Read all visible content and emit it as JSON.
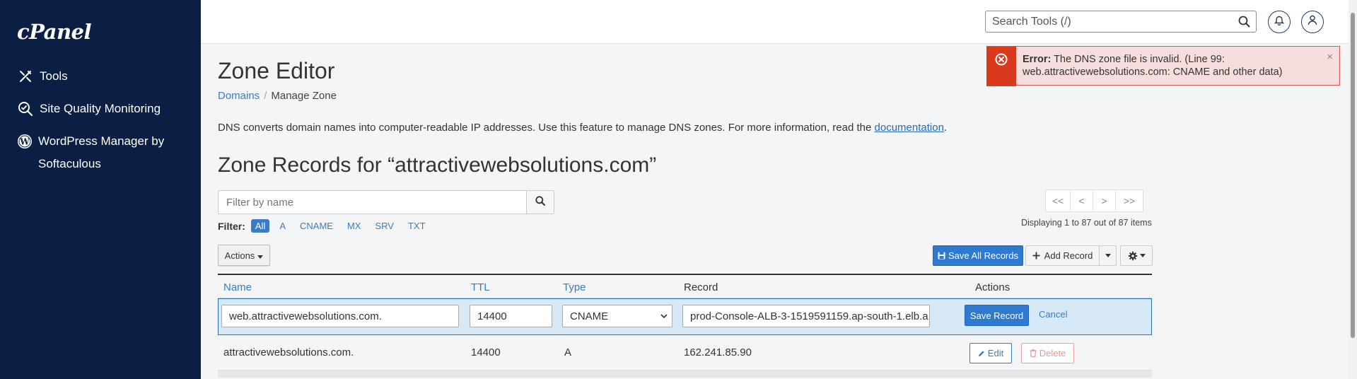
{
  "sidebar": {
    "logo": "cPanel",
    "items": [
      {
        "label": "Tools"
      },
      {
        "label": "Site Quality Monitoring"
      },
      {
        "label": "WordPress Manager by Softaculous"
      }
    ]
  },
  "header": {
    "search_placeholder": "Search Tools (/)"
  },
  "alert": {
    "prefix": "Error:",
    "message": "The DNS zone file is invalid. (Line 99: web.attractivewebsolutions.com: CNAME and other data)",
    "close": "×"
  },
  "page": {
    "title": "Zone Editor",
    "breadcrumb": {
      "parent": "Domains",
      "separator": "/",
      "current": "Manage Zone"
    },
    "description": "DNS converts domain names into computer-readable IP addresses. Use this feature to manage DNS zones. For more information, read the",
    "doc_link": "documentation",
    "doc_suffix": ".",
    "zone_title": "Zone Records for “attractivewebsolutions.com”"
  },
  "filter": {
    "placeholder": "Filter by name",
    "label": "Filter:",
    "options": [
      "All",
      "A",
      "CNAME",
      "MX",
      "SRV",
      "TXT"
    ],
    "active": "All"
  },
  "pager": {
    "first": "<<",
    "prev": "<",
    "next": ">",
    "last": ">>",
    "display_text": "Displaying 1 to 87 out of 87 items"
  },
  "toolbar": {
    "actions_label": "Actions",
    "save_all_label": "Save All Records",
    "add_record_label": "Add Record"
  },
  "table": {
    "headers": {
      "name": "Name",
      "ttl": "TTL",
      "type": "Type",
      "record": "Record",
      "actions": "Actions"
    },
    "edit_row": {
      "name": "web.attractivewebsolutions.com.",
      "ttl": "14400",
      "type": "CNAME",
      "record": "prod-Console-ALB-3-1519591159.ap-south-1.elb.a",
      "save_label": "Save Record",
      "cancel_label": "Cancel"
    },
    "rows": [
      {
        "name": "attractivewebsolutions.com.",
        "ttl": "14400",
        "type": "A",
        "record": "162.241.85.90",
        "edit_label": "Edit",
        "delete_label": "Delete"
      }
    ]
  },
  "colors": {
    "sidebar_bg": "#0b1f45",
    "primary": "#2f7ad1",
    "link": "#3b7bbf",
    "error": "#d9391c",
    "edit_row_bg": "#d7e9f7"
  }
}
